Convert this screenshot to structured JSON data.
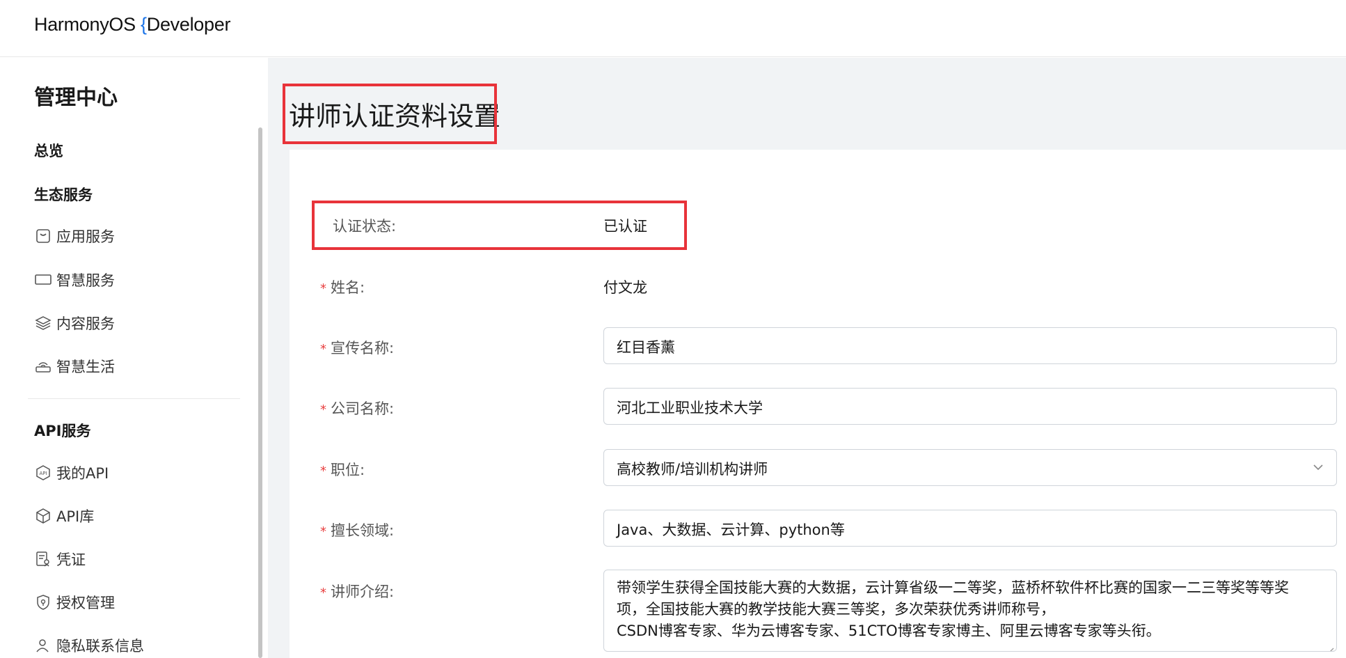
{
  "header": {
    "logo_main": "HarmonyOS ",
    "logo_brace": "{",
    "logo_suffix": "Developer"
  },
  "sidebar": {
    "title": "管理中心",
    "overview": "总览",
    "eco_section": "生态服务",
    "eco_items": [
      {
        "label": "应用服务",
        "icon": "app-icon"
      },
      {
        "label": "智慧服务",
        "icon": "screen-icon"
      },
      {
        "label": "内容服务",
        "icon": "layers-icon"
      },
      {
        "label": "智慧生活",
        "icon": "router-icon"
      }
    ],
    "api_section": "API服务",
    "api_items": [
      {
        "label": "我的API",
        "icon": "api-badge-icon"
      },
      {
        "label": "API库",
        "icon": "cube-icon"
      },
      {
        "label": "凭证",
        "icon": "credential-icon"
      },
      {
        "label": "授权管理",
        "icon": "shield-icon"
      },
      {
        "label": "隐私联系信息",
        "icon": "user-icon"
      }
    ]
  },
  "page": {
    "title": "讲师认证资料设置"
  },
  "form": {
    "status_label": "认证状态:",
    "status_value": "已认证",
    "name_label": "姓名:",
    "name_value": "付文龙",
    "promo_label": "宣传名称:",
    "promo_value": "红目香薰",
    "company_label": "公司名称:",
    "company_value": "河北工业职业技术大学",
    "position_label": "职位:",
    "position_value": "高校教师/培训机构讲师",
    "expertise_label": "擅长领域:",
    "expertise_value": "Java、大数据、云计算、python等",
    "intro_label": "讲师介绍:",
    "intro_line1": "带领学生获得全国技能大赛的大数据，云计算省级一二等奖，蓝桥杯软件杯比赛的国家一二三等奖等等奖",
    "intro_line2": "项，全国技能大赛的教学技能大赛三等奖，多次荣获优秀讲师称号，",
    "intro_line3": "CSDN博客专家、华为云博客专家、51CTO博客专家博主、阿里云博客专家等头衔。",
    "required_mark": "*"
  },
  "colors": {
    "highlight": "#e8333a",
    "required": "#e84040",
    "accent": "#1a73e8"
  }
}
